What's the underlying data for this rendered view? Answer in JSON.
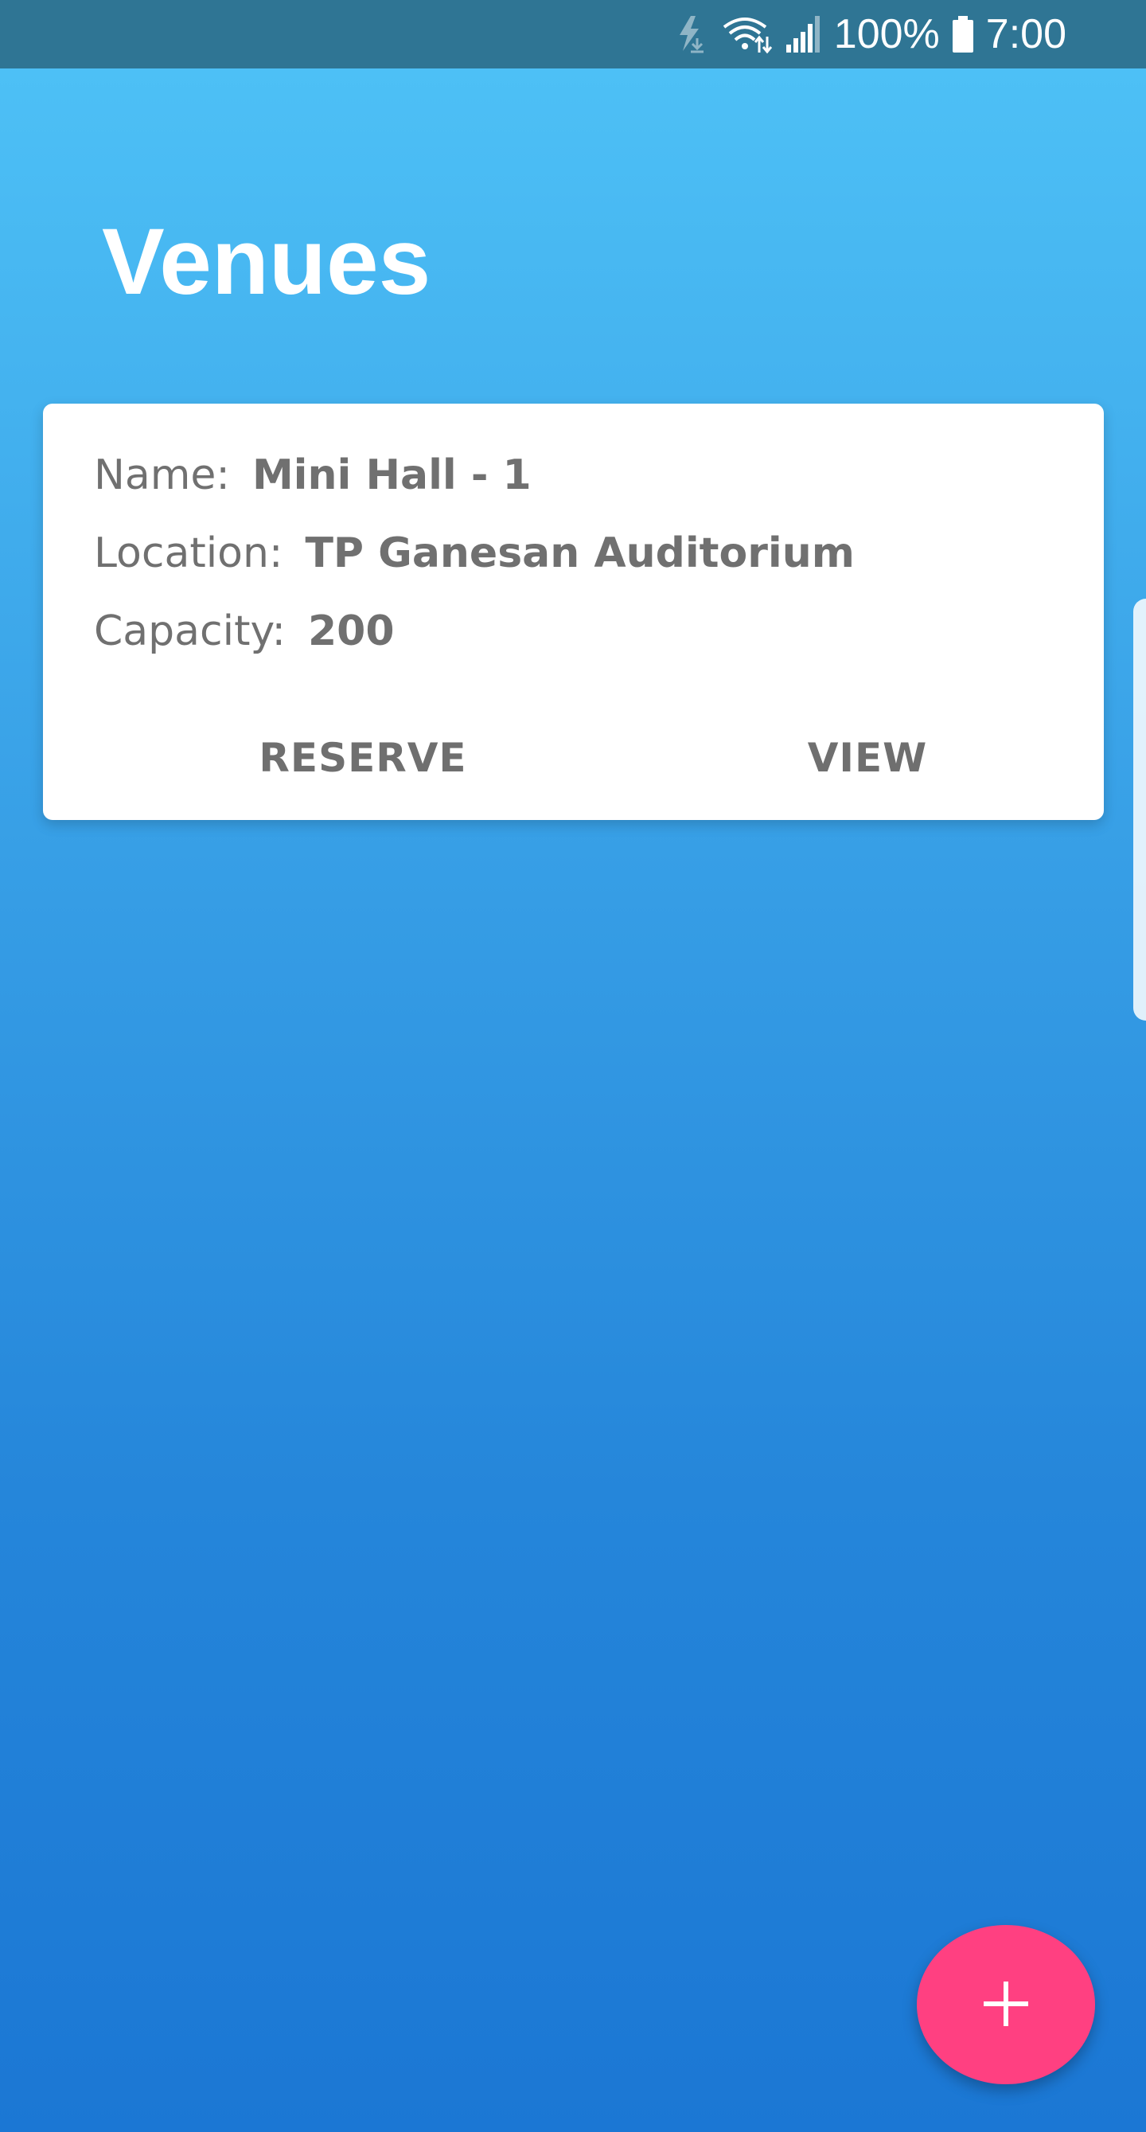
{
  "status_bar": {
    "battery_text": "100%",
    "time": "7:00",
    "icons": [
      "flash-download-icon",
      "wifi-icon",
      "signal-icon",
      "battery-icon"
    ]
  },
  "page": {
    "title": "Venues"
  },
  "venues": [
    {
      "name_label": "Name:",
      "name": "Mini Hall - 1",
      "location_label": "Location:",
      "location": "TP Ganesan Auditorium",
      "capacity_label": "Capacity:",
      "capacity": "200",
      "reserve_label": "RESERVE",
      "view_label": "VIEW"
    }
  ],
  "fab": {
    "icon": "plus-icon"
  },
  "colors": {
    "status_bar": "#2f7594",
    "background_top": "#4fc3f7",
    "background_bottom": "#1b77d4",
    "card": "#ffffff",
    "card_text": "#707070",
    "fab": "#ff4081"
  }
}
